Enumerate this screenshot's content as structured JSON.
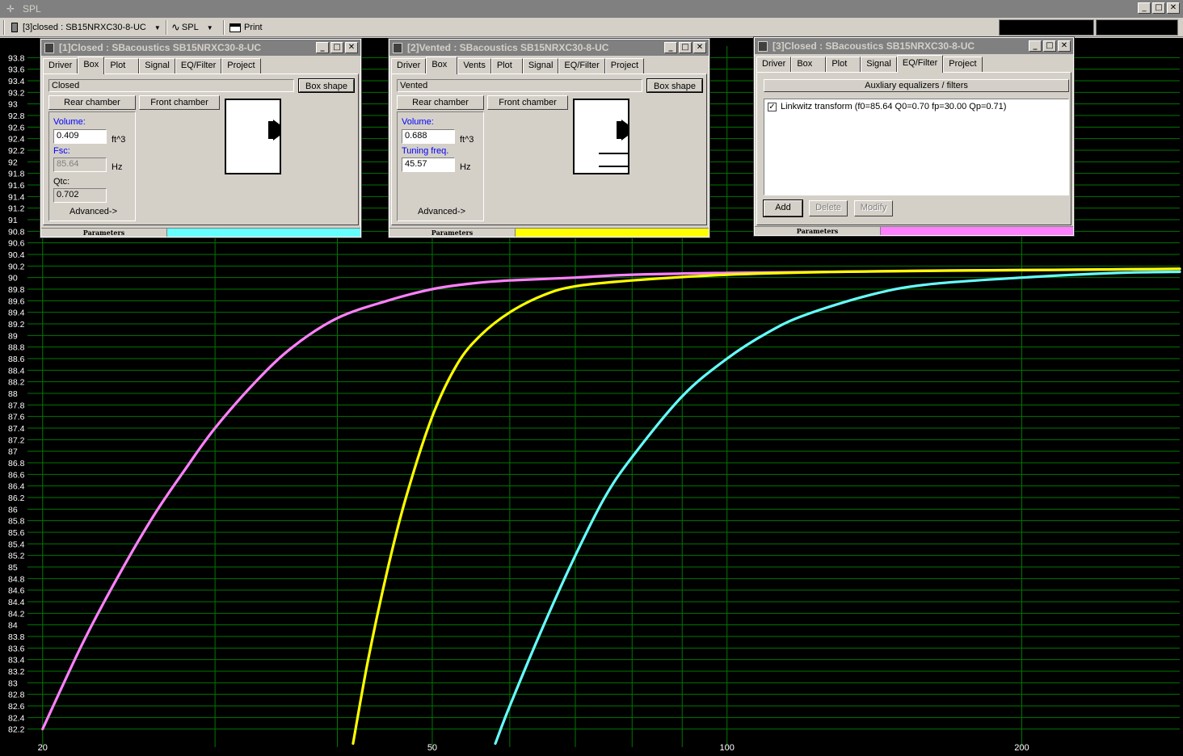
{
  "app": {
    "title": "SPL",
    "title_icon": "crosshair-icon",
    "caption": {
      "minimize": "_",
      "maximize": "□",
      "close": "✕"
    }
  },
  "toolbar": {
    "project_select": "[3]closed : SB15NRXC30-8-UC",
    "view_select": "SPL",
    "print_label": "Print",
    "dropdown_arrow": "▼"
  },
  "window1": {
    "title": "[1]Closed : SBacoustics SB15NRXC30-8-UC",
    "tabs": [
      "Driver",
      "Box",
      "Plot",
      "Signal",
      "EQ/Filter",
      "Project"
    ],
    "active_tab": "Box",
    "box_type": "Closed",
    "box_shape_label": "Box shape",
    "rear_chamber_label": "Rear chamber",
    "front_chamber_label": "Front chamber",
    "volume_label": "Volume:",
    "volume_value": "0.409",
    "volume_unit": "ft^3",
    "fsc_label": "Fsc:",
    "fsc_value": "85.64",
    "fsc_unit": "Hz",
    "qtc_label": "Qtc:",
    "qtc_value": "0.702",
    "advanced_label": "Advanced->",
    "status_label": "Parameters",
    "color": "#66ffff"
  },
  "window2": {
    "title": "[2]Vented : SBacoustics SB15NRXC30-8-UC",
    "tabs": [
      "Driver",
      "Box",
      "Vents",
      "Plot",
      "Signal",
      "EQ/Filter",
      "Project"
    ],
    "active_tab": "Box",
    "box_type": "Vented",
    "box_shape_label": "Box shape",
    "rear_chamber_label": "Rear chamber",
    "front_chamber_label": "Front chamber",
    "volume_label": "Volume:",
    "volume_value": "0.688",
    "volume_unit": "ft^3",
    "tuning_label": "Tuning freq.",
    "tuning_value": "45.57",
    "tuning_unit": "Hz",
    "advanced_label": "Advanced->",
    "status_label": "Parameters",
    "color": "#ffff00"
  },
  "window3": {
    "title": "[3]Closed : SBacoustics SB15NRXC30-8-UC",
    "tabs": [
      "Driver",
      "Box",
      "Plot",
      "Signal",
      "EQ/Filter",
      "Project"
    ],
    "active_tab": "EQ/Filter",
    "aux_header": "Auxliary equalizers / filters",
    "filter_item": "Linkwitz transform (f0=85.64 Q0=0.70 fp=30.00 Qp=0.71)",
    "filter_checked": true,
    "add_label": "Add",
    "delete_label": "Delete",
    "modify_label": "Modify",
    "status_label": "Parameters",
    "color": "#ff80ff"
  },
  "chart_data": {
    "type": "line",
    "title": "",
    "xlabel": "",
    "ylabel": "",
    "x_scale": "log",
    "xlim": [
      19.3,
      290
    ],
    "ylim": [
      82.0,
      94.0
    ],
    "x_tick_labels": [
      "20",
      "50",
      "100",
      "200"
    ],
    "y_tick_labels": [
      "93.8",
      "93.6",
      "93.4",
      "93.2",
      "93",
      "92.8",
      "92.6",
      "92.4",
      "92.2",
      "92",
      "91.8",
      "91.6",
      "91.4",
      "91.2",
      "91",
      "90.8",
      "90.6",
      "90.4",
      "90.2",
      "90",
      "89.8",
      "89.6",
      "89.4",
      "89.2",
      "89",
      "88.8",
      "88.6",
      "88.4",
      "88.2",
      "88",
      "87.8",
      "87.6",
      "87.4",
      "87.2",
      "87",
      "86.8",
      "86.6",
      "86.4",
      "86.2",
      "86",
      "85.8",
      "85.6",
      "85.4",
      "85.2",
      "85",
      "84.8",
      "84.6",
      "84.4",
      "84.2",
      "84",
      "83.8",
      "83.6",
      "83.4",
      "83.2",
      "83",
      "82.8",
      "82.6",
      "82.4",
      "82.2"
    ],
    "grid": true,
    "background": "#000000",
    "grid_color": "#007700",
    "series": [
      {
        "color": "#ff80ff",
        "x": [
          20,
          22,
          24,
          26,
          28,
          30,
          33,
          36,
          40,
          45,
          50,
          55,
          60,
          70,
          80,
          100,
          130,
          160,
          200,
          290
        ],
        "y": [
          82.2,
          83.7,
          84.9,
          85.9,
          86.7,
          87.4,
          88.2,
          88.8,
          89.3,
          89.6,
          89.8,
          89.9,
          89.95,
          90.0,
          90.05,
          90.08,
          90.1,
          90.12,
          90.13,
          90.15
        ]
      },
      {
        "color": "#ffff00",
        "x": [
          41.5,
          43,
          45,
          47,
          50,
          53,
          56,
          60,
          65,
          70,
          80,
          100,
          130,
          200,
          290
        ],
        "y": [
          81.95,
          83.4,
          84.95,
          86.2,
          87.6,
          88.5,
          89.0,
          89.4,
          89.7,
          89.85,
          89.95,
          90.05,
          90.1,
          90.13,
          90.15
        ]
      },
      {
        "color": "#66ffff",
        "x": [
          58,
          60,
          65,
          70,
          75,
          80,
          90,
          100,
          110,
          120,
          140,
          160,
          200,
          250,
          290
        ],
        "y": [
          81.95,
          82.6,
          84.0,
          85.2,
          86.2,
          86.9,
          87.95,
          88.6,
          89.05,
          89.35,
          89.7,
          89.88,
          90.0,
          90.08,
          90.1
        ]
      }
    ]
  }
}
